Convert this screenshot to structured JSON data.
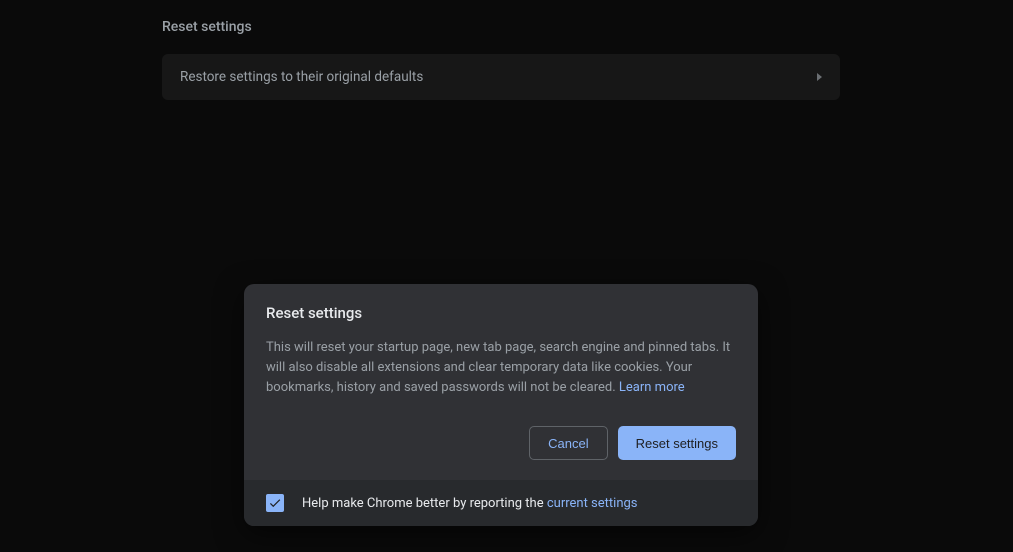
{
  "section": {
    "title": "Reset settings",
    "row": {
      "label": "Restore settings to their original defaults"
    }
  },
  "dialog": {
    "title": "Reset settings",
    "description": "This will reset your startup page, new tab page, search engine and pinned tabs. It will also disable all extensions and clear temporary data like cookies. Your bookmarks, history and saved passwords will not be cleared. ",
    "learn_more": "Learn more",
    "cancel": "Cancel",
    "confirm": "Reset settings",
    "footer_text": "Help make Chrome better by reporting the ",
    "footer_link": "current settings"
  }
}
